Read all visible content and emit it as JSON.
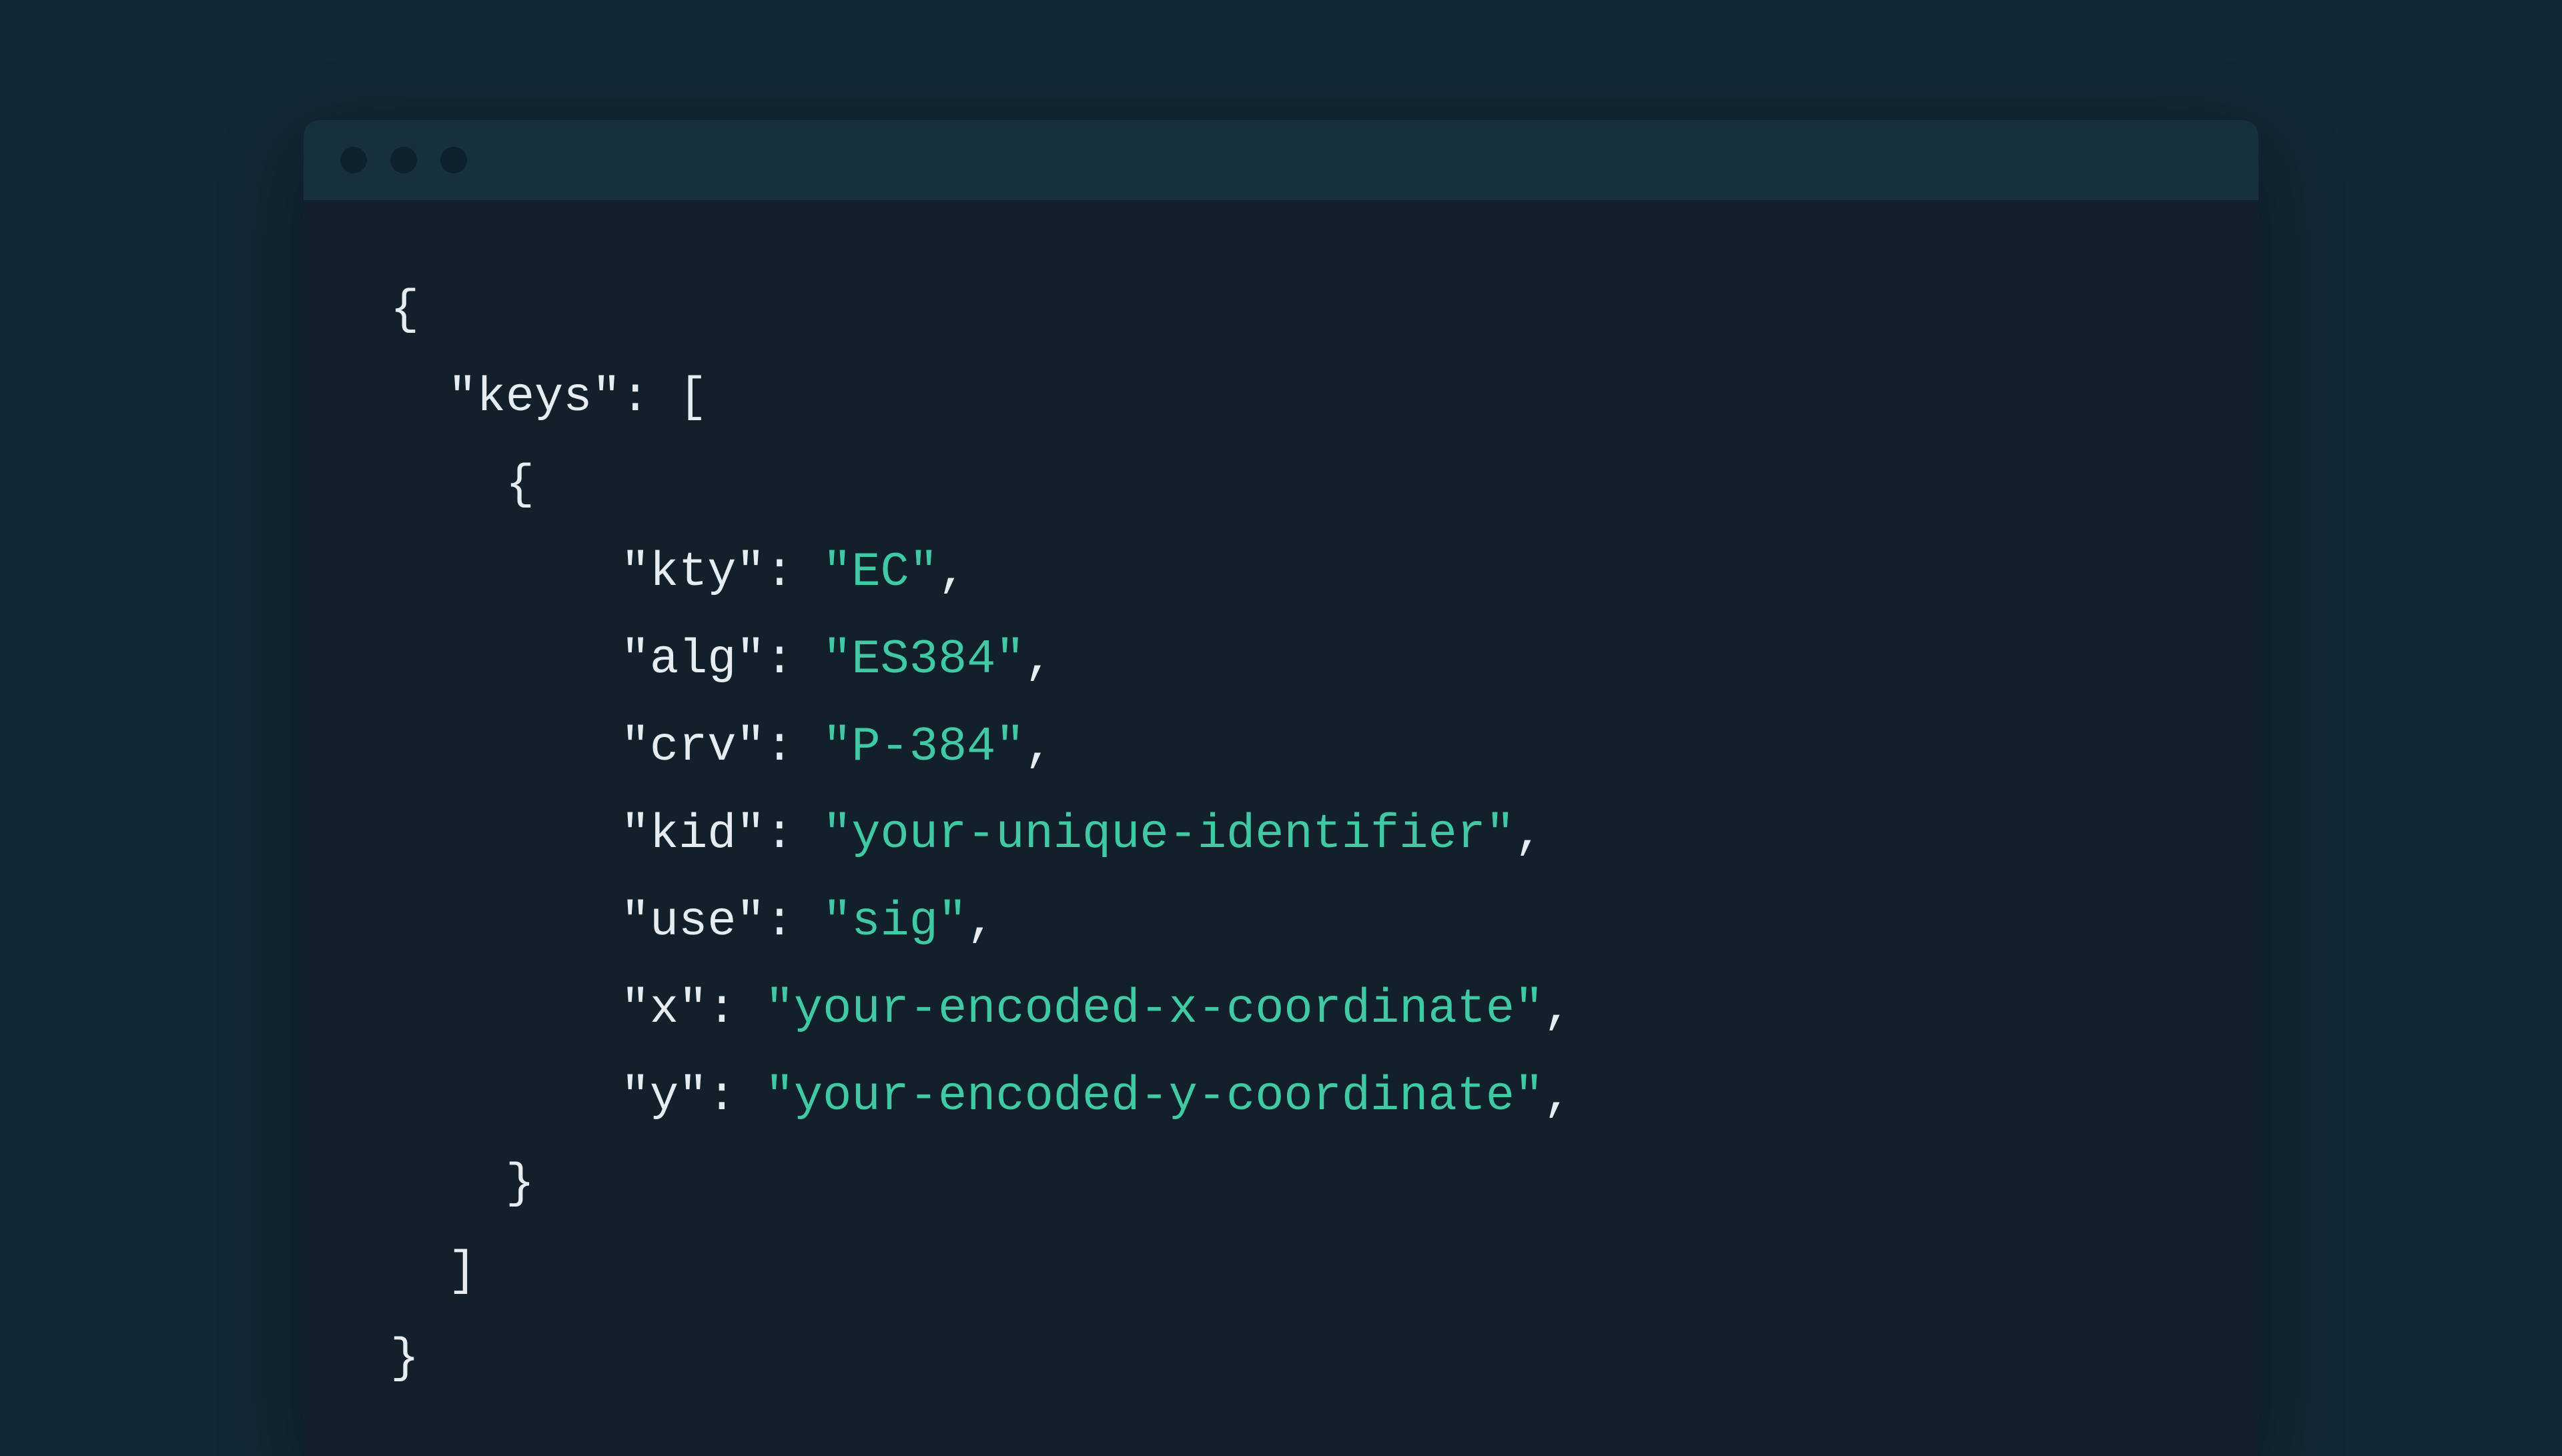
{
  "code": {
    "root_key": "\"keys\"",
    "entries": [
      {
        "key": "\"kty\"",
        "value": "\"EC\""
      },
      {
        "key": "\"alg\"",
        "value": "\"ES384\""
      },
      {
        "key": "\"crv\"",
        "value": "\"P-384\""
      },
      {
        "key": "\"kid\"",
        "value": "\"your-unique-identifier\""
      },
      {
        "key": "\"use\"",
        "value": "\"sig\""
      },
      {
        "key": "\"x\"",
        "value": "\"your-encoded-x-coordinate\""
      },
      {
        "key": "\"y\"",
        "value": "\"your-encoded-y-coordinate\""
      }
    ],
    "brace_open": "{",
    "brace_close": "}",
    "bracket_open": "[",
    "bracket_close": "]",
    "colon": ": ",
    "comma": ","
  },
  "colors": {
    "page_bg": "#122734",
    "window_bg": "#16303e",
    "code_bg": "#11202b",
    "text": "#e6ecf0",
    "string": "#40c9a2",
    "dot": "#0e222e"
  }
}
